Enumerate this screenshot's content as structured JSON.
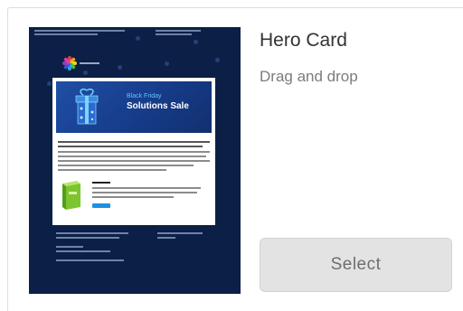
{
  "card": {
    "title": "Hero Card",
    "subtitle": "Drag and drop",
    "select_label": "Select"
  },
  "colors": {
    "thumbnail_bg": "#0c1f46",
    "banner_bg": "#1f4fa6",
    "select_bg": "#e3e3e3",
    "title_text": "#333333",
    "subtitle_text": "#7c7c7c",
    "cta_blue": "#1e90e0"
  },
  "thumbnail": {
    "icon": "email-template-preview",
    "banner_line1": "Black Friday",
    "banner_line2": "Solutions Sale"
  }
}
